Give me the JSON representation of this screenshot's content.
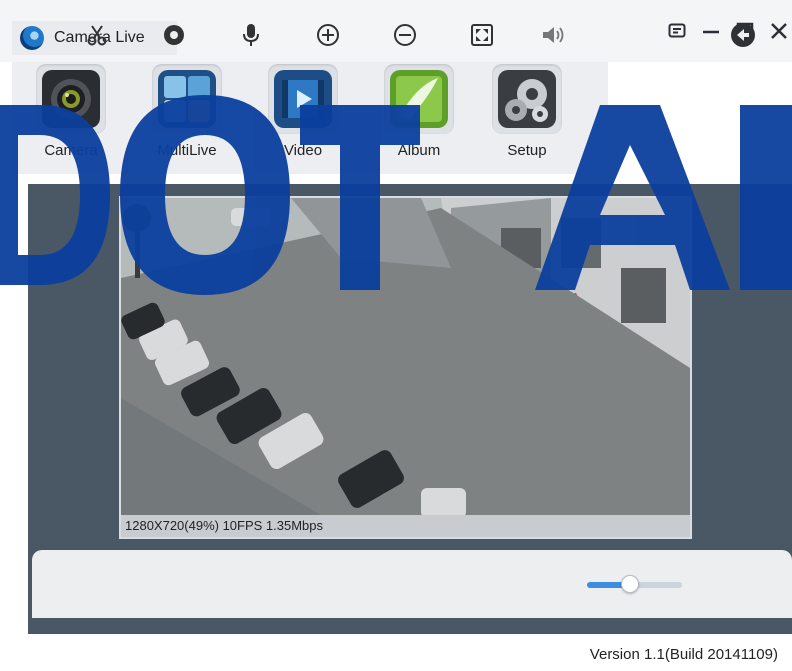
{
  "window": {
    "title": "Camera Live",
    "controls": [
      "menu-icon",
      "minimize-icon",
      "maximize-icon",
      "close-icon"
    ]
  },
  "toolbar": {
    "items": [
      {
        "label": "Camera",
        "icon": "camera-icon"
      },
      {
        "label": "MultiLive",
        "icon": "multilive-icon"
      },
      {
        "label": "Video",
        "icon": "video-icon"
      },
      {
        "label": "Album",
        "icon": "album-icon"
      },
      {
        "label": "Setup",
        "icon": "setup-gears-icon"
      }
    ]
  },
  "video": {
    "stats": "1280X720(49%) 10FPS 1.35Mbps"
  },
  "controls": {
    "icons": [
      "scissors-icon",
      "record-icon",
      "microphone-icon",
      "zoom-in-icon",
      "zoom-out-icon",
      "fullscreen-icon",
      "volume-icon",
      "back-icon"
    ],
    "volume_level": 0.45
  },
  "footer": {
    "version": "Version 1.1(Build 20141109)"
  },
  "colors": {
    "panel": "#4a5865",
    "accent": "#3d8ee0",
    "watermark": "#0b3f9e"
  }
}
